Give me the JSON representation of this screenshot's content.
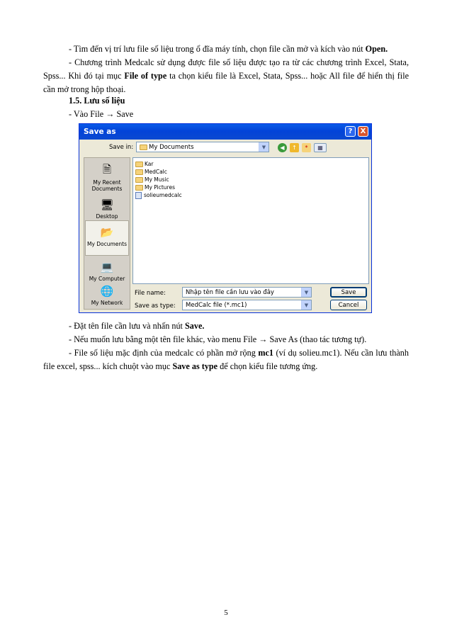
{
  "para1": {
    "text": "- Tìm đến vị trí lưu file số liệu trong ổ đĩa máy tính, chọn file cần mở và kích vào nút ",
    "bold": "Open."
  },
  "para2": {
    "t1": "- Chương trình Medcalc sử dụng được file số liệu được tạo ra từ các chương trình Excel, Stata, Spss... Khi đó tại mục ",
    "b1": "File of type",
    "t2": " ta chọn kiểu file là Excel, Stata, Spss... hoặc All file để hiển thị file cần mở trong hộp thoại."
  },
  "heading": "1.5. Lưu số liệu",
  "step_vao_file": "- Vào File → Save",
  "dialog": {
    "title": "Save as",
    "help_glyph": "?",
    "close_glyph": "X",
    "save_in_label": "Save in:",
    "save_in_value": "My Documents",
    "places": [
      {
        "label": "My Recent Documents",
        "icon": "recent-documents-icon"
      },
      {
        "label": "Desktop",
        "icon": "desktop-icon"
      },
      {
        "label": "My Documents",
        "icon": "my-documents-icon"
      },
      {
        "label": "My Computer",
        "icon": "my-computer-icon"
      },
      {
        "label": "My Network",
        "icon": "my-network-icon"
      }
    ],
    "files": [
      {
        "name": "Kar",
        "type": "folder"
      },
      {
        "name": "MedCalc",
        "type": "folder"
      },
      {
        "name": "My Music",
        "type": "folder"
      },
      {
        "name": "My Pictures",
        "type": "folder"
      },
      {
        "name": "solieumedcalc",
        "type": "file"
      }
    ],
    "file_name_label": "File name:",
    "file_name_value": "Nhập tên file cần lưu vào đây",
    "save_as_type_label": "Save as type:",
    "save_as_type_value": "MedCalc file (*.mc1)",
    "save_button": "Save",
    "cancel_button": "Cancel"
  },
  "para3": {
    "text": "- Đặt tên file cần lưu và nhấn nút ",
    "bold": "Save."
  },
  "para4": "- Nếu muốn lưu bằng một tên file khác, vào menu File → Save As (thao tác tương tự).",
  "para5": {
    "t1": "- File số liệu mặc định của medcalc có phần mở rộng ",
    "b1": "mc1",
    "t2": " (ví dụ solieu.mc1). Nếu cần lưu thành file excel, spss... kích chuột vào mục ",
    "b2": "Save as type",
    "t3": " để chọn kiểu file tương ứng."
  },
  "page_number": "5"
}
